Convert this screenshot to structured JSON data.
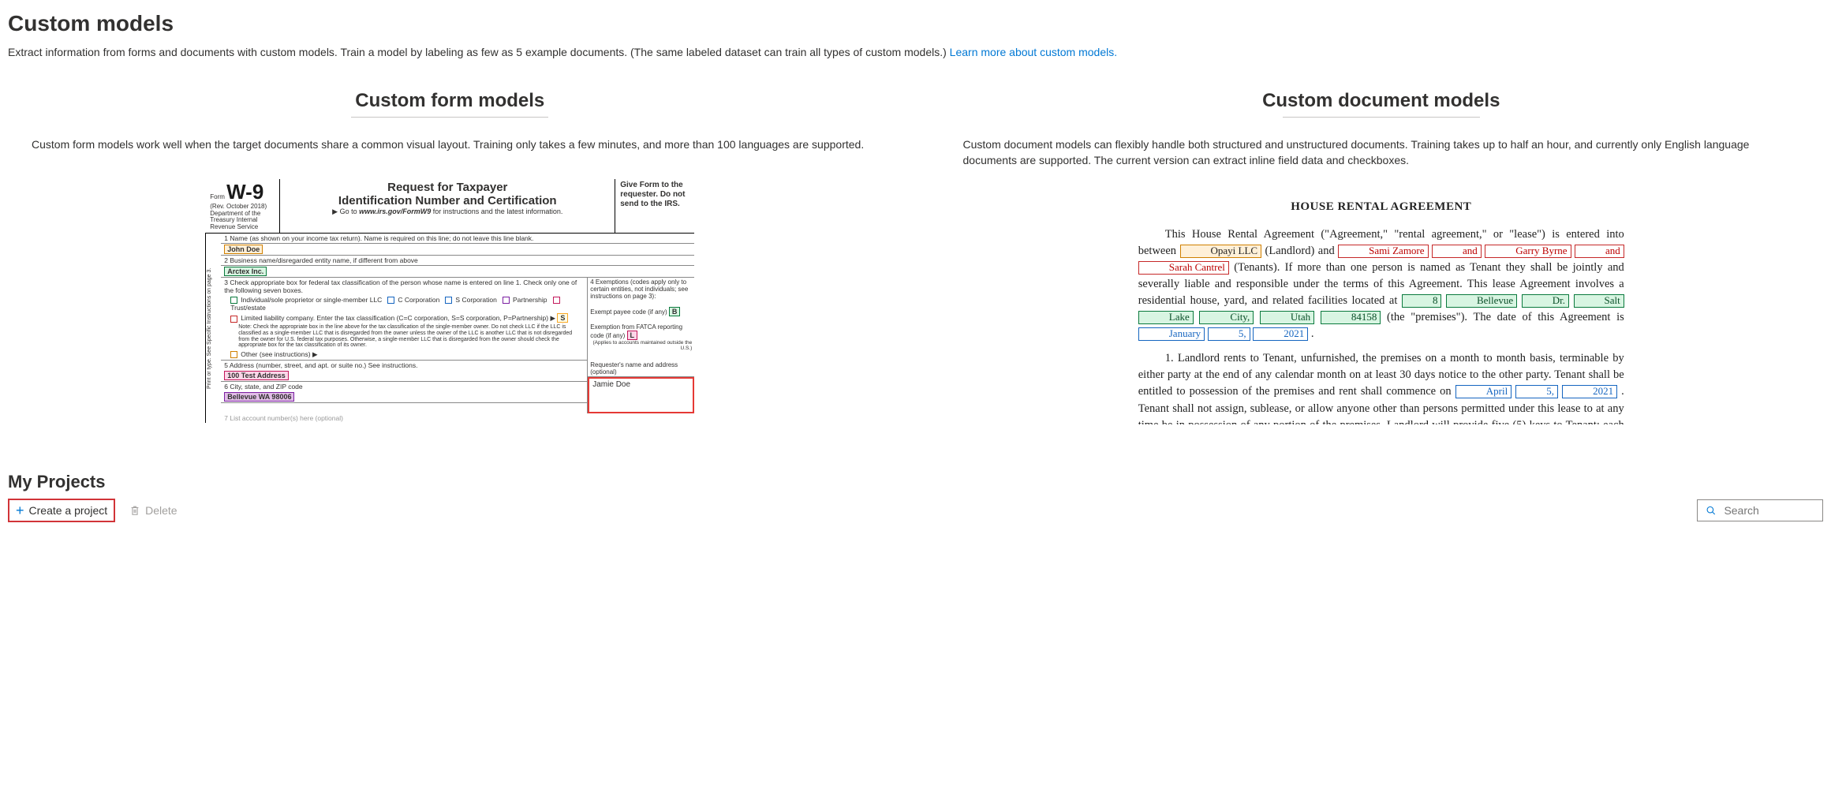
{
  "page": {
    "title": "Custom models",
    "subtitle": "Extract information from forms and documents with custom models. Train a model by labeling as few as 5 example documents. (The same labeled dataset can train all types of custom models.) ",
    "learn_more": "Learn more about custom models."
  },
  "columns": {
    "form": {
      "heading": "Custom form models",
      "desc": "Custom form models work well when the target documents share a common visual layout. Training only takes a few minutes, and more than 100 languages are supported."
    },
    "doc": {
      "heading": "Custom document models",
      "desc": "Custom document models can flexibly handle both structured and unstructured documents. Training takes up to half an hour, and currently only English language documents are supported. The current version can extract inline field data and checkboxes."
    }
  },
  "w9": {
    "form_label": "Form",
    "form_id": "W-9",
    "rev": "(Rev. October 2018)",
    "dept": "Department of the Treasury Internal Revenue Service",
    "title1": "Request for Taxpayer",
    "title2": "Identification Number and Certification",
    "goto_pre": "▶ Go to ",
    "goto_url": "www.irs.gov/FormW9",
    "goto_post": " for instructions and the latest information.",
    "give": "Give Form to the requester. Do not send to the IRS.",
    "side": "Print or type.     See Specific Instructions on page 3.",
    "l1": "1  Name (as shown on your income tax return). Name is required on this line; do not leave this line blank.",
    "name": "John Doe",
    "l2": "2  Business name/disregarded entity name, if different from above",
    "biz": "Arctex Inc.",
    "l3": "3  Check appropriate box for federal tax classification of the person whose name is entered on line 1. Check only one of the following seven boxes.",
    "cb_ind": "Individual/sole proprietor or single-member LLC",
    "cb_c": "C Corporation",
    "cb_s": "S Corporation",
    "cb_p": "Partnership",
    "cb_t": "Trust/estate",
    "llc_line": "Limited liability company. Enter the tax classification (C=C corporation, S=S corporation, P=Partnership) ▶",
    "llc_val": "S",
    "note": "Note: Check the appropriate box in the line above for the tax classification of the single-member owner. Do not check LLC if the LLC is classified as a single-member LLC that is disregarded from the owner unless the owner of the LLC is another LLC that is not disregarded from the owner for U.S. federal tax purposes. Otherwise, a single-member LLC that is disregarded from the owner should check the appropriate box for the tax classification of its owner.",
    "other": "Other (see instructions) ▶",
    "ex4": "4  Exemptions (codes apply only to certain entities, not individuals; see instructions on page 3):",
    "ex_payee": "Exempt payee code (if any)",
    "ex_payee_v": "B",
    "ex_fatca": "Exemption from FATCA reporting code (if any)",
    "ex_fatca_v": "L",
    "ex_note": "(Applies to accounts maintained outside the U.S.)",
    "l5": "5  Address (number, street, and apt. or suite no.) See instructions.",
    "addr": "100 Test Address",
    "l6": "6  City, state, and ZIP code",
    "csz": "Bellevue WA 98006",
    "l7": "7  List account number(s) here (optional)",
    "req_head": "Requester's name and address (optional)",
    "req_name": "Jamie Doe"
  },
  "doc_sample": {
    "title": "HOUSE RENTAL AGREEMENT",
    "landlord": "Opayi LLC",
    "tenants": [
      "Sami Zamore",
      "and",
      "Garry Byrne",
      "and",
      "Sarah Cantrel"
    ],
    "address_parts": [
      "8",
      "Bellevue",
      "Dr.",
      "Salt",
      "Lake",
      "City,",
      "Utah",
      "84158"
    ],
    "date_parts": [
      "January",
      "5,",
      "2021"
    ],
    "commence_parts": [
      "April",
      "5,",
      "2021"
    ],
    "p1a": "This House Rental Agreement (\"Agreement,\" \"rental agreement,\" or \"lease\") is entered into between ",
    "p1b": " (Landlord) and ",
    "p1c": " (Tenants).  If more than one person is named as Tenant they shall be jointly and severally liable and responsible under the terms of this Agreement.  This lease Agreement involves a residential house, yard, and related facilities located at ",
    "p1d": " (the \"premises\"). The date of this Agreement is ",
    "p1e": ".",
    "p2a": "1.        Landlord rents to Tenant, unfurnished, the premises on a month to month basis, terminable by either party at the end of any calendar month on at least 30 days notice to the other party.  Tenant shall be entitled to possession of the premises and rent shall commence on ",
    "p2b": ".  Tenant shall not assign, sublease, or allow anyone other than persons permitted under this lease to at any time be in possession of any portion of the premises.  Landlord will provide five (5) keys to Tenant; each key fits all outside door locks.  Landlord will also provide two keys to the garage, and one remote garage door opener.  All keys and the remote door opener will be returned"
  },
  "projects": {
    "heading": "My Projects",
    "create": "Create a project",
    "delete": "Delete",
    "search_placeholder": "Search"
  }
}
